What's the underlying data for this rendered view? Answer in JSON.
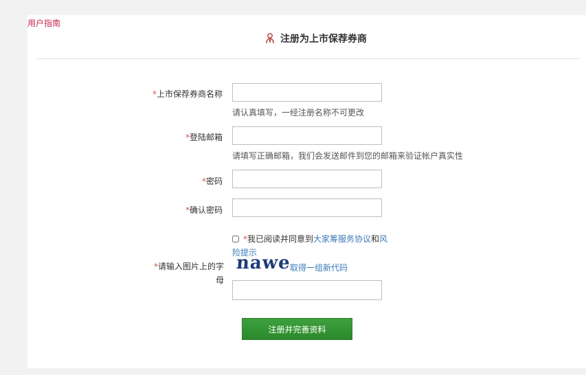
{
  "guide_link": "用户指南",
  "title": "注册为上市保荐券商",
  "form": {
    "name": {
      "label": "上市保荐券商名称",
      "value": "",
      "hint": "请认真填写，一经注册名称不可更改"
    },
    "email": {
      "label": "登陆邮箱",
      "value": "",
      "hint": "请填写正确邮箱，我们会发送邮件到您的邮箱来验证帐户真实性"
    },
    "password": {
      "label": "密码",
      "value": ""
    },
    "confirm_password": {
      "label": "确认密码",
      "value": ""
    },
    "agreement": {
      "checked": false,
      "prefix": "我已阅读并同意到",
      "service_link": "大家筹服务协议",
      "and": "和",
      "risk_link": "风险提示"
    },
    "captcha": {
      "label": "请输入图片上的字母",
      "image_text": "nawe",
      "refresh_link": "取得一组新代码",
      "value": ""
    },
    "required_mark": "*"
  },
  "submit_label": "注册并完善资料"
}
